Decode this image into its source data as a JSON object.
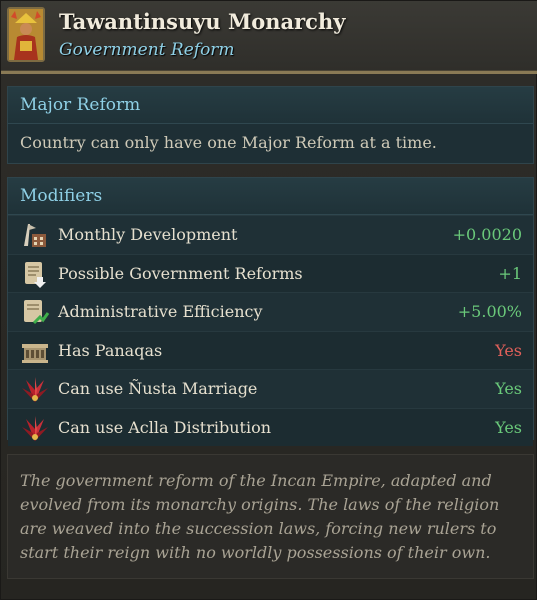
{
  "header": {
    "title": "Tawantinsuyu Monarchy",
    "subtitle": "Government Reform",
    "portrait_icon": "inca-ruler-portrait-icon"
  },
  "major_reform": {
    "heading": "Major Reform",
    "text": "Country can only have one Major Reform at a time."
  },
  "modifiers": {
    "heading": "Modifiers",
    "items": [
      {
        "label": "Monthly Development",
        "value": "+0.0020",
        "color": "#6ac97a",
        "icon": "development-icon"
      },
      {
        "label": "Possible Government Reforms",
        "value": "+1",
        "color": "#6ac97a",
        "icon": "reform-scroll-icon"
      },
      {
        "label": "Administrative Efficiency",
        "value": "+5.00%",
        "color": "#6ac97a",
        "icon": "admin-efficiency-icon"
      },
      {
        "label": "Has Panaqas",
        "value": "Yes",
        "color": "#e0605a",
        "icon": "panaqa-building-icon"
      },
      {
        "label": "Can use Ñusta Marriage",
        "value": "Yes",
        "color": "#6ac97a",
        "icon": "feather-emblem-icon"
      },
      {
        "label": "Can use Aclla Distribution",
        "value": "Yes",
        "color": "#6ac97a",
        "icon": "feather-emblem-icon"
      }
    ]
  },
  "description": "The government reform of the Incan Empire, adapted and evolved from its monarchy origins. The laws of the religion are weaved into the succession laws, forcing new rulers to start their reign with no worldly possessions of their own.",
  "colors": {
    "accent_blue": "#8fd0e6",
    "positive": "#6ac97a",
    "negative": "#e0605a",
    "gold_border": "#8a7a55"
  }
}
